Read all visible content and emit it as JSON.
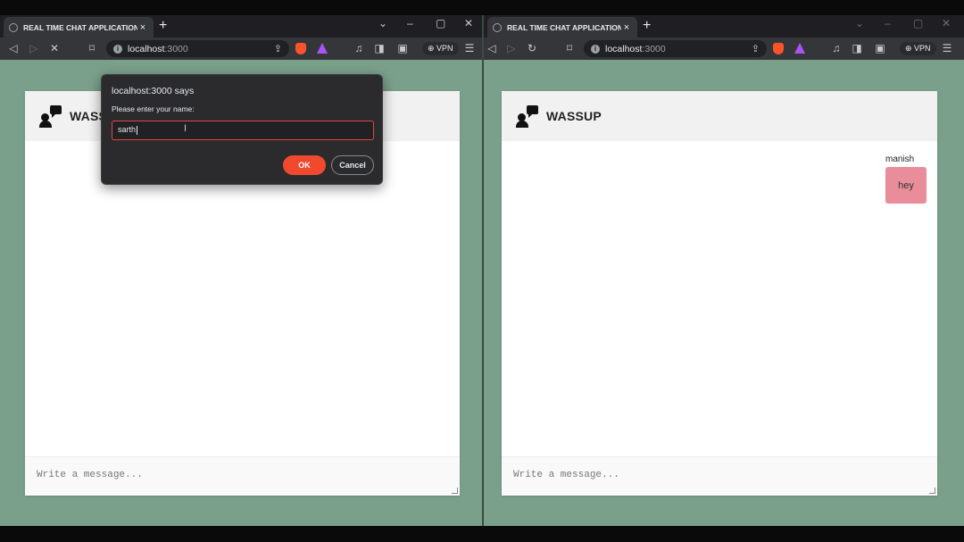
{
  "left_window": {
    "tab_title": "REAL TIME CHAT APPLICATION",
    "url_host": "localhost",
    "url_port": ":3000",
    "vpn_label": "VPN",
    "app_brand": "WASS",
    "compose_placeholder": "Write a message..."
  },
  "right_window": {
    "tab_title": "REAL TIME CHAT APPLICATION",
    "url_host": "localhost",
    "url_port": ":3000",
    "vpn_label": "VPN",
    "app_brand": "WASSUP",
    "compose_placeholder": "Write a message...",
    "messages": [
      {
        "sender": "manish",
        "text": "hey"
      }
    ]
  },
  "dialog": {
    "title": "localhost:3000 says",
    "label": "Please enter your name:",
    "input_value": "sarth",
    "ok_label": "OK",
    "cancel_label": "Cancel"
  },
  "icons": {
    "back": "back-arrow-icon",
    "forward": "forward-arrow-icon",
    "stop": "stop-icon",
    "reload": "reload-icon",
    "bookmark": "bookmark-icon",
    "share": "share-icon",
    "brave": "brave-shield-icon",
    "rewards": "brave-rewards-icon",
    "media": "music-note-icon",
    "sidebar": "sidebar-icon",
    "wallet": "wallet-icon",
    "menu": "hamburger-menu-icon"
  },
  "colors": {
    "page_background": "#7aa08c",
    "ok_button": "#f0492e",
    "message_bubble": "#e88d99"
  }
}
